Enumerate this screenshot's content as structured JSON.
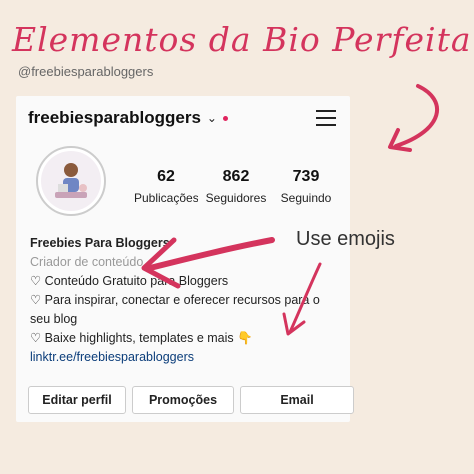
{
  "page": {
    "title": "Elementos da Bio Perfeita",
    "handle": "@freebiesparabloggers",
    "annotation": "Use emojis"
  },
  "colors": {
    "accent": "#d4345d",
    "background": "#f5ebe0",
    "link": "#0b3d7a"
  },
  "profile": {
    "username": "freebiesparabloggers",
    "chevron_icon": "chevron-down-icon",
    "menu_icon": "hamburger-menu-icon",
    "stats": [
      {
        "value": "62",
        "label": "Publicações"
      },
      {
        "value": "862",
        "label": "Seguidores"
      },
      {
        "value": "739",
        "label": "Seguindo"
      }
    ],
    "bio": {
      "name": "Freebies Para Bloggers",
      "category": "Criador de conteúdo",
      "line1": "♡ Conteúdo Gratuito para Bloggers",
      "line2": "♡ Para inspirar, conectar e oferecer recursos para o seu blog",
      "line3": "♡ Baixe highlights, templates e mais 👇",
      "link": "linktr.ee/freebiesparabloggers"
    },
    "buttons": {
      "edit": "Editar perfil",
      "promotions": "Promoções",
      "email": "Email"
    }
  }
}
